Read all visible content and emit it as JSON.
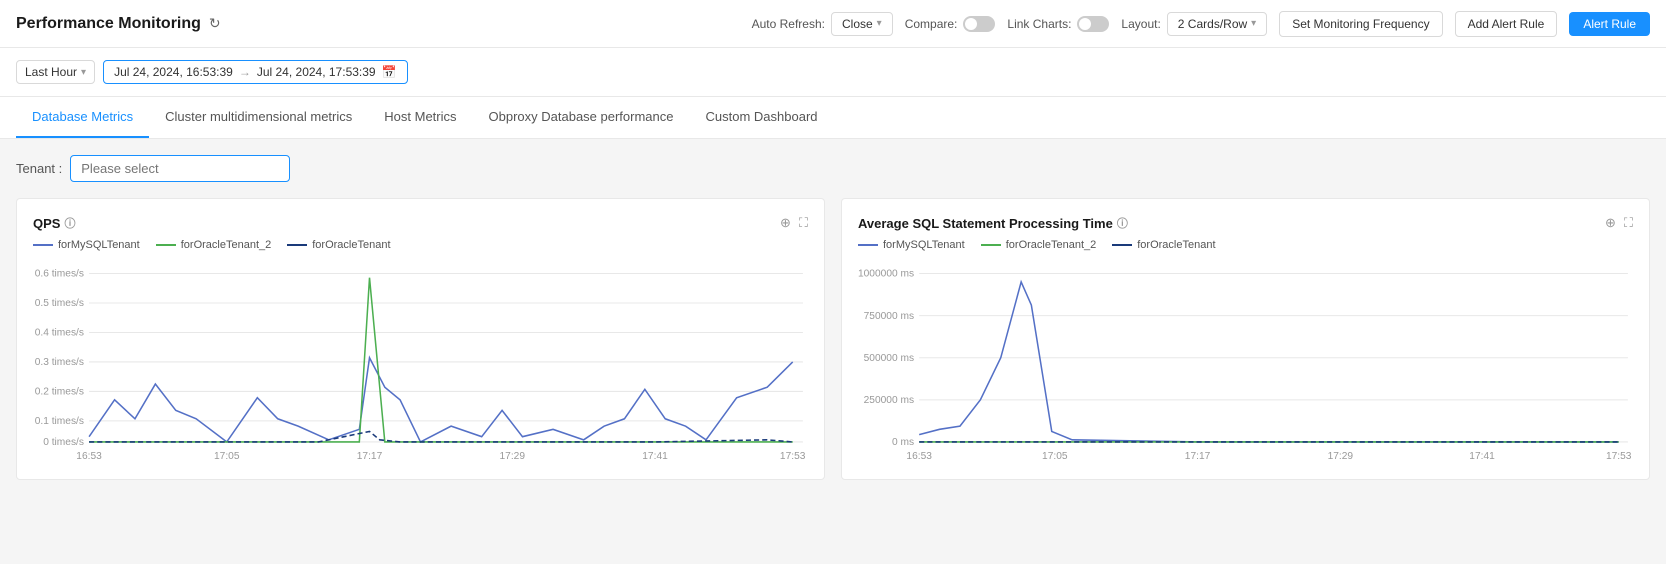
{
  "header": {
    "title": "Performance Monitoring",
    "auto_refresh_label": "Auto Refresh:",
    "auto_refresh_value": "Close",
    "compare_label": "Compare:",
    "link_charts_label": "Link Charts:",
    "layout_label": "Layout:",
    "layout_value": "2 Cards/Row",
    "set_monitoring_btn": "Set Monitoring Frequency",
    "add_alert_btn": "Add Alert Rule",
    "alert_rule_btn": "Alert Rule"
  },
  "time_bar": {
    "range_label": "Last Hour",
    "start_time": "Jul 24, 2024, 16:53:39",
    "end_time": "Jul 24, 2024, 17:53:39"
  },
  "tabs": [
    {
      "id": "database-metrics",
      "label": "Database Metrics",
      "active": true
    },
    {
      "id": "cluster-metrics",
      "label": "Cluster multidimensional metrics",
      "active": false
    },
    {
      "id": "host-metrics",
      "label": "Host Metrics",
      "active": false
    },
    {
      "id": "obproxy",
      "label": "Obproxy Database performance",
      "active": false
    },
    {
      "id": "custom-dashboard",
      "label": "Custom Dashboard",
      "active": false
    }
  ],
  "tenant": {
    "label": "Tenant :",
    "placeholder": "Please select"
  },
  "charts": {
    "qps": {
      "title": "QPS",
      "legend": [
        {
          "name": "forMySQLTenant",
          "color": "#5470c6",
          "style": "solid"
        },
        {
          "name": "forOracleTenant_2",
          "color": "#4caf50",
          "style": "solid"
        },
        {
          "name": "forOracleTenant",
          "color": "#1a3a7a",
          "style": "dashed"
        }
      ],
      "y_labels": [
        "0.6 times/s",
        "0.5 times/s",
        "0.4 times/s",
        "0.3 times/s",
        "0.2 times/s",
        "0.1 times/s",
        "0 times/s"
      ],
      "x_labels": [
        "16:53",
        "17:05",
        "17:17",
        "17:29",
        "17:41",
        "17:53"
      ]
    },
    "avg_sql": {
      "title": "Average SQL Statement Processing Time",
      "legend": [
        {
          "name": "forMySQLTenant",
          "color": "#5470c6",
          "style": "solid"
        },
        {
          "name": "forOracleTenant_2",
          "color": "#4caf50",
          "style": "solid"
        },
        {
          "name": "forOracleTenant",
          "color": "#1a3a7a",
          "style": "dashed"
        }
      ],
      "y_labels": [
        "1000000 ms",
        "750000 ms",
        "500000 ms",
        "250000 ms",
        "0 ms"
      ],
      "x_labels": [
        "16:53",
        "17:05",
        "17:17",
        "17:29",
        "17:41",
        "17:53"
      ]
    }
  }
}
